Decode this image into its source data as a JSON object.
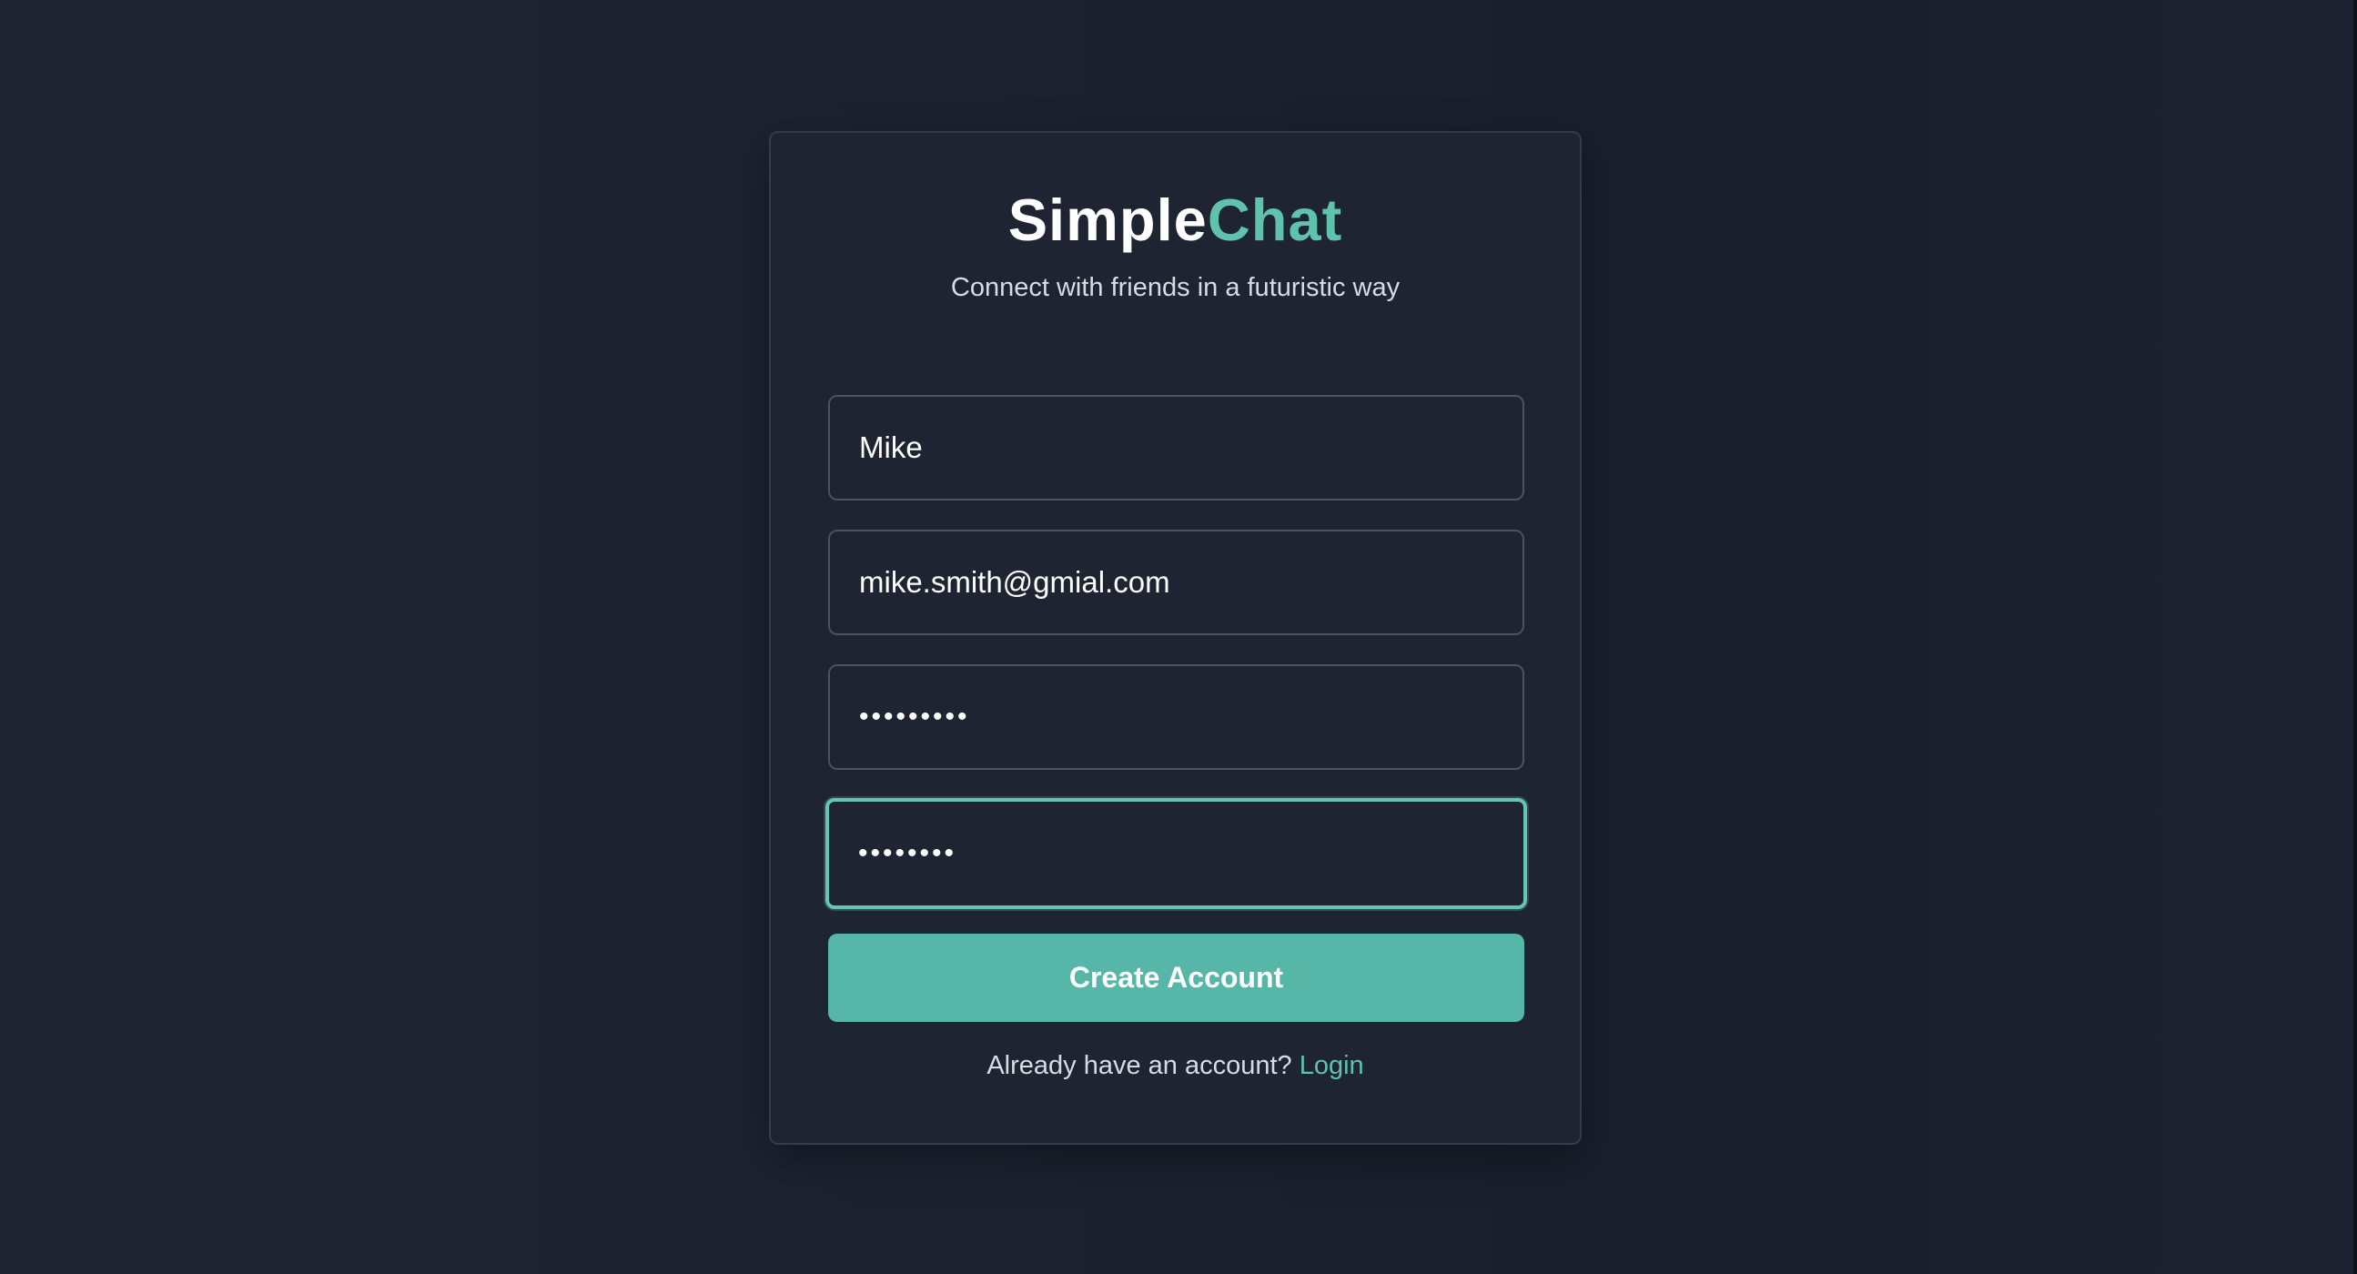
{
  "brand": {
    "part1": "Simple",
    "part2": "Chat"
  },
  "tagline": "Connect with friends in a futuristic way",
  "form": {
    "username": {
      "value": "Mike",
      "focused": false
    },
    "email": {
      "value": "mike.smith@gmial.com",
      "focused": false
    },
    "password": {
      "value": "•••••••••",
      "focused": false
    },
    "confirm_password": {
      "value": "••••••••",
      "focused": true
    },
    "submit_label": "Create Account"
  },
  "footer": {
    "prompt": "Already have an account?",
    "link_label": "Login"
  },
  "colors": {
    "accent": "#5ec2ad",
    "button": "#56b6a8",
    "background": "#1c2230",
    "card": "#1f2432",
    "border": "#4a5162"
  }
}
